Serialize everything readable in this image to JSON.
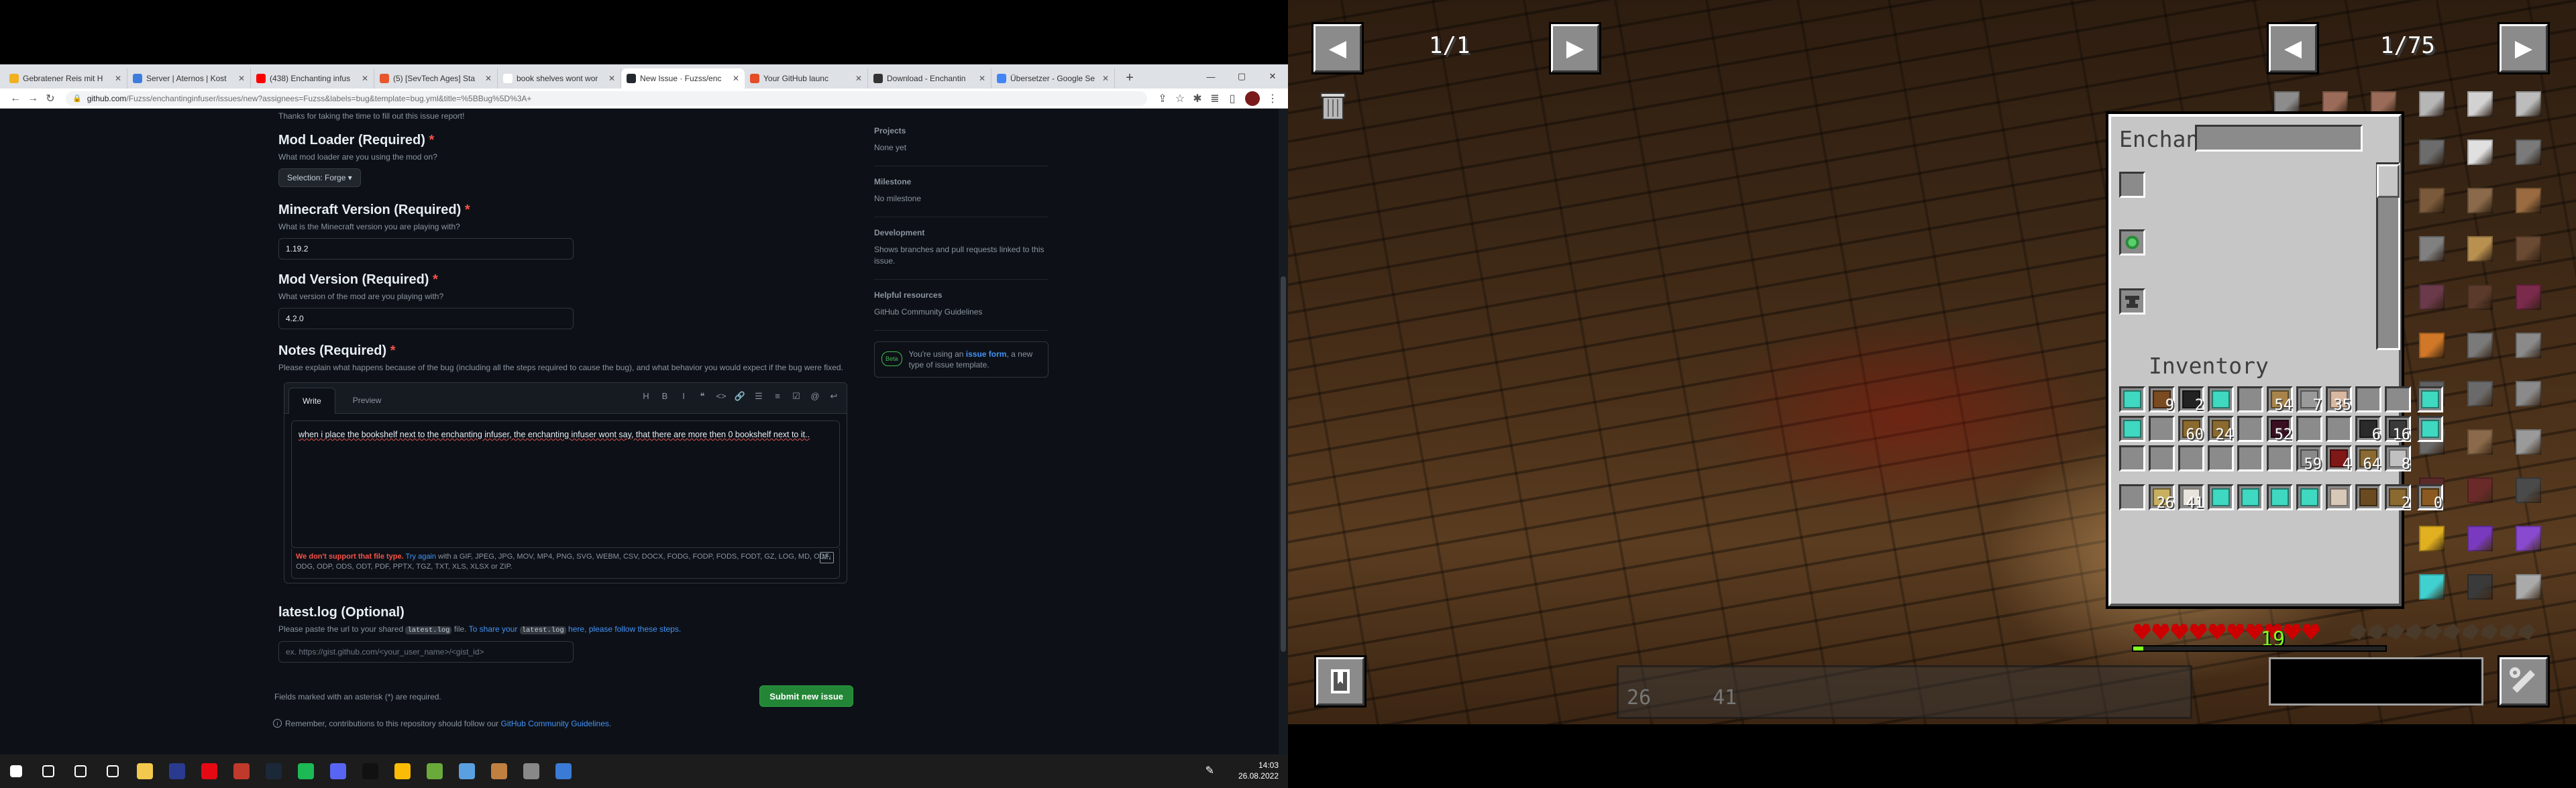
{
  "browser": {
    "tabs": [
      {
        "label": "Gebratener Reis mit H",
        "color": "#f2b01e"
      },
      {
        "label": "Server | Aternos | Kost",
        "color": "#3b7ddd"
      },
      {
        "label": "(438) Enchanting infus",
        "color": "#ff0000"
      },
      {
        "label": "(5) [SevTech Ages] Sta",
        "color": "#e8572c"
      },
      {
        "label": "book shelves wont wor",
        "color": "#ffffff"
      },
      {
        "label": "New Issue · Fuzss/enc",
        "color": "#24292f",
        "active": true
      },
      {
        "label": "Your GitHub launc",
        "color": "#e44d26"
      },
      {
        "label": "Download - Enchantin",
        "color": "#333333"
      },
      {
        "label": "Übersetzer - Google Se",
        "color": "#4285f4"
      }
    ],
    "new_tab": "+",
    "window_controls": {
      "minimize": "—",
      "maximize": "▢",
      "close": "✕"
    },
    "url_host": "github.com",
    "url_path": "/Fuzss/enchantinginfuser/issues/new?assignees=Fuzss&labels=bug&template=bug.yml&title=%5BBug%5D%3A+"
  },
  "form": {
    "cutoff": "Thanks for taking the time to fill out this issue report!",
    "req_marker": "*",
    "mod_loader": {
      "title": "Mod Loader (Required)",
      "desc": "What mod loader are you using the mod on?",
      "value": "Selection: Forge"
    },
    "mc_version": {
      "title": "Minecraft Version (Required)",
      "desc": "What is the Minecraft version you are playing with?",
      "value": "1.19.2"
    },
    "mod_version": {
      "title": "Mod Version (Required)",
      "desc": "What version of the mod are you playing with?",
      "value": "4.2.0"
    },
    "notes": {
      "title": "Notes (Required)",
      "desc": "Please explain what happens because of the bug (including all the steps required to cause the bug), and what behavior you would expect if the bug were fixed.",
      "tab_write": "Write",
      "tab_preview": "Preview",
      "tools": [
        "H",
        "B",
        "I",
        "❝",
        "<>",
        "🔗",
        "☰",
        "≡",
        "☑",
        "@",
        "↩"
      ],
      "text_a": "when i place the bookshelf next to the enchanting infuser, the enchanting infuser wont say, that there are more then 0 bookshelf next to it..",
      "err": "We don't support that file type.",
      "try_again": "Try again",
      "err_rest": "with a GIF, JPEG, JPG, MOV, MP4, PNG, SVG, WEBM, CSV, DOCX, FODG, FODP, FODS, FODT, GZ, LOG, MD, ODF, ODG, ODP, ODS, ODT, PDF, PPTX, TGZ, TXT, XLS, XLSX or ZIP.",
      "md_badge": "M↓"
    },
    "log": {
      "title": "latest.log (Optional)",
      "desc_a": "Please paste the url to your shared",
      "desc_code": "latest.log",
      "desc_b": "file.",
      "desc_link_a": "To share your",
      "desc_link_b": "here, please follow these steps.",
      "placeholder": "ex. https://gist.github.com/<your_user_name>/<gist_id>"
    },
    "required_note": "Fields marked with an asterisk (*) are required.",
    "submit": "Submit new issue",
    "remember_a": "Remember, contributions to this repository should follow our",
    "remember_link": "GitHub Community Guidelines",
    "remember_end": "."
  },
  "sidebar": {
    "projects_h": "Projects",
    "projects_v": "None yet",
    "milestone_h": "Milestone",
    "milestone_v": "No milestone",
    "dev_h": "Development",
    "dev_v": "Shows branches and pull requests linked to this issue.",
    "help_h": "Helpful resources",
    "help_link": "GitHub Community Guidelines",
    "beta_badge": "Beta",
    "beta_a": "You're using an",
    "beta_link": "issue form",
    "beta_b": ", a new type of issue template."
  },
  "taskbar": {
    "icons": [
      {
        "name": "windows-start-icon",
        "color": "#ffffff"
      },
      {
        "name": "search-icon",
        "color": "#ffffff"
      },
      {
        "name": "cortana-icon",
        "color": "#ffffff"
      },
      {
        "name": "task-view-icon",
        "color": "#ffffff"
      },
      {
        "name": "file-explorer-icon",
        "color": "#f2c94c"
      },
      {
        "name": "app-icon",
        "color": "#2a3b8f"
      },
      {
        "name": "netflix-icon",
        "color": "#e50914"
      },
      {
        "name": "app-icon",
        "color": "#c0392b"
      },
      {
        "name": "steam-icon",
        "color": "#1b2838"
      },
      {
        "name": "spotify-icon",
        "color": "#1db954"
      },
      {
        "name": "discord-icon",
        "color": "#5865f2"
      },
      {
        "name": "tiktok-icon",
        "color": "#111111"
      },
      {
        "name": "chrome-icon",
        "color": "#fbbc05"
      },
      {
        "name": "minecraft-icon",
        "color": "#6aaa3a"
      },
      {
        "name": "app-icon",
        "color": "#5aa0e0"
      },
      {
        "name": "app-icon",
        "color": "#c08040"
      },
      {
        "name": "shield-icon",
        "color": "#888888"
      },
      {
        "name": "app-icon",
        "color": "#3a7bd5"
      }
    ],
    "time": "14:03",
    "date": "26.08.2022"
  },
  "minecraft": {
    "left_page": "1/1",
    "right_page": "1/75",
    "prev": "◀",
    "next": "▶",
    "gui_title": "Enchant",
    "inventory_label": "Inventory",
    "xp_level": "19",
    "hotbar_first_count": "26",
    "hotbar_second_count": "41",
    "inv": [
      {
        "row": 0,
        "col": 0,
        "color": "#7a4a20",
        "count": "9"
      },
      {
        "row": 0,
        "col": 1,
        "color": "#222222",
        "count": "2"
      },
      {
        "row": 0,
        "col": 2,
        "color": "#3fd8c0",
        "count": ""
      },
      {
        "row": 0,
        "col": 3,
        "color": "",
        "count": ""
      },
      {
        "row": 0,
        "col": 4,
        "color": "#a8844a",
        "count": "54"
      },
      {
        "row": 0,
        "col": 5,
        "color": "#9a9a9a",
        "count": "7"
      },
      {
        "row": 0,
        "col": 6,
        "color": "#d8b8a0",
        "count": "35"
      },
      {
        "row": 0,
        "col": 7,
        "color": "",
        "count": ""
      },
      {
        "row": 0,
        "col": 8,
        "color": "",
        "count": ""
      },
      {
        "row": 1,
        "col": 0,
        "color": "",
        "count": ""
      },
      {
        "row": 1,
        "col": 1,
        "color": "#8a6a30",
        "count": "60"
      },
      {
        "row": 1,
        "col": 2,
        "color": "#8a6a30",
        "count": "24"
      },
      {
        "row": 1,
        "col": 3,
        "color": "",
        "count": ""
      },
      {
        "row": 1,
        "col": 4,
        "color": "#3a1020",
        "count": "52"
      },
      {
        "row": 1,
        "col": 5,
        "color": "",
        "count": ""
      },
      {
        "row": 1,
        "col": 6,
        "color": "",
        "count": ""
      },
      {
        "row": 1,
        "col": 7,
        "color": "#2a2a2a",
        "count": "6"
      },
      {
        "row": 1,
        "col": 8,
        "color": "#3a3a3a",
        "count": "16"
      },
      {
        "row": 2,
        "col": 0,
        "color": "",
        "count": ""
      },
      {
        "row": 2,
        "col": 1,
        "color": "",
        "count": ""
      },
      {
        "row": 2,
        "col": 2,
        "color": "",
        "count": ""
      },
      {
        "row": 2,
        "col": 3,
        "color": "",
        "count": ""
      },
      {
        "row": 2,
        "col": 4,
        "color": "",
        "count": ""
      },
      {
        "row": 2,
        "col": 5,
        "color": "#8a8a8a",
        "count": "59"
      },
      {
        "row": 2,
        "col": 6,
        "color": "#801818",
        "count": "4"
      },
      {
        "row": 2,
        "col": 7,
        "color": "#8a6a30",
        "count": "64"
      },
      {
        "row": 2,
        "col": 8,
        "color": "#c0c0c0",
        "count": "8"
      },
      {
        "row": 3,
        "col": 0,
        "color": "#c8b060",
        "count": "26"
      },
      {
        "row": 3,
        "col": 1,
        "color": "#e8e4dc",
        "count": "41"
      },
      {
        "row": 3,
        "col": 2,
        "color": "#3fd8c0",
        "count": ""
      },
      {
        "row": 3,
        "col": 3,
        "color": "#3fd8c0",
        "count": ""
      },
      {
        "row": 3,
        "col": 4,
        "color": "#3fd8c0",
        "count": ""
      },
      {
        "row": 3,
        "col": 5,
        "color": "#3fd8c0",
        "count": ""
      },
      {
        "row": 3,
        "col": 6,
        "color": "#d8c8b8",
        "count": ""
      },
      {
        "row": 3,
        "col": 7,
        "color": "#6a4a20",
        "count": ""
      },
      {
        "row": 3,
        "col": 8,
        "color": "#8a6a30",
        "count": "2"
      }
    ],
    "side_slots": [
      {
        "color": "#3fd8c0",
        "count": "",
        "kind": "helmet"
      },
      {
        "color": "#3fd8c0",
        "count": "",
        "kind": "chest"
      },
      {
        "color": "",
        "count": "",
        "kind": "legs"
      },
      {
        "color": "",
        "count": "",
        "kind": "boots"
      }
    ],
    "right_slots": [
      {
        "color": "#3fd8c0",
        "count": ""
      },
      {
        "color": "#3fd8c0",
        "count": ""
      }
    ],
    "extra_slot": {
      "color": "#d8d8d8",
      "count": ""
    },
    "book_slot": {
      "color": "#8a5a20",
      "count": "0"
    },
    "jei_blocks": [
      "#8c8c8c",
      "#9a6b58",
      "#9a6b58",
      "#b6b6b6",
      "#d2d2d2",
      "#bcbcbc",
      "#909090",
      "#8a5a42",
      "#5a5a5a",
      "#6c6c6c",
      "#e0e0e0",
      "#7a7a7a",
      "#8a5a3a",
      "#3a7a3a",
      "#7a5a3a",
      "#7a5a3a",
      "#8a6a4a",
      "#9a6b40",
      "#4a4a4a",
      "#8a1a1a",
      "#2a6a6a",
      "#808080",
      "#b89050",
      "#6a4a32",
      "#d8cc98",
      "#a0693a",
      "#b6551a",
      "#6a3a4a",
      "#5a3a2a",
      "#7a2a4a",
      "#2a7a7a",
      "#6a6a6a",
      "#e0d8c0",
      "#d07828",
      "#7a7a7a",
      "#8a8a8a",
      "#5a5a5a",
      "#7a7a7a",
      "#a0a0a0",
      "#606060",
      "#6a6a6a",
      "#8a8a8a",
      "#8a7a3a",
      "#6a5a6a",
      "#3a6a3a",
      "#6a6a6a",
      "#8a6a4a",
      "#9a9a9a",
      "#3a5a7a",
      "#3a6a8a",
      "#6a7a8a",
      "#5a2a2a",
      "#6a2a2a",
      "#4a4a4a",
      "#0a0a14",
      "#9a7a5a",
      "#9a7a5a",
      "#e0b020",
      "#7a3ac0",
      "#8a4ad0",
      "#e0e0e0",
      "#b0806a",
      "#f0d020",
      "#40d0d0",
      "#3a3a3a",
      "#aaaaaa"
    ]
  }
}
